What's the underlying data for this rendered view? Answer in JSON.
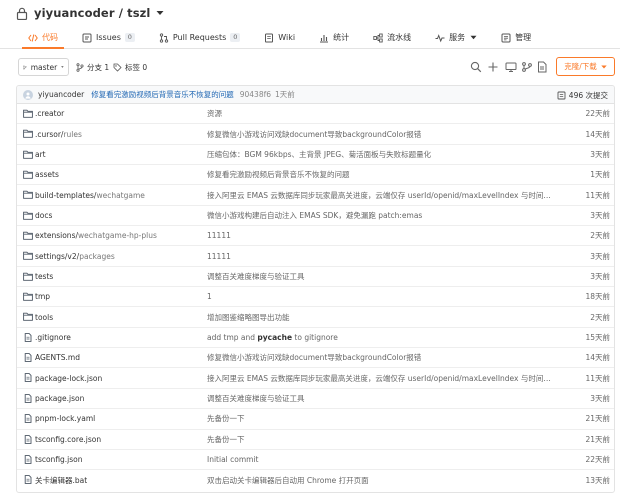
{
  "repo": {
    "title": "yiyuancoder / tszl",
    "lock_icon": "lock-icon"
  },
  "tabs": [
    {
      "label": "代码",
      "icon": "code-icon",
      "active": true
    },
    {
      "label": "Issues",
      "icon": "issues-icon",
      "badge": "0"
    },
    {
      "label": "Pull Requests",
      "icon": "pull-request-icon",
      "badge": "0"
    },
    {
      "label": "Wiki",
      "icon": "wiki-icon"
    },
    {
      "label": "统计",
      "icon": "stats-icon"
    },
    {
      "label": "流水线",
      "icon": "pipeline-icon"
    },
    {
      "label": "服务",
      "icon": "pulse-icon",
      "dropdown": true
    },
    {
      "label": "管理",
      "icon": "settings-icon"
    }
  ],
  "toolbar": {
    "branch": "master",
    "branches": "分支 1",
    "tags": "标签 0",
    "clone_label": "克隆/下载"
  },
  "commit": {
    "author": "yiyuancoder",
    "message": "修复看完激励视频后背景音乐不恢复的问题",
    "sha": "90438f6",
    "time": "1天前",
    "count": "496 次提交"
  },
  "files": [
    {
      "type": "folder",
      "name": ".creator",
      "message": "资源",
      "time": "22天前"
    },
    {
      "type": "folder",
      "name": ".cursor/",
      "name_dim": "rules",
      "message": "修复微信小游戏访问戏缺document导致backgroundColor报错",
      "time": "14天前"
    },
    {
      "type": "folder",
      "name": "art",
      "message": "压缩包体：BGM 96kbps、主背景 JPEG、菊活面板与失败标题量化",
      "time": "3天前"
    },
    {
      "type": "folder",
      "name": "assets",
      "message": "修复看完激励视频后背景音乐不恢复的问题",
      "time": "1天前"
    },
    {
      "type": "folder",
      "name": "build-templates/",
      "name_dim": "wechatgame",
      "message": "接入阿里云 EMAS 云数据库同步玩家最高关进度，云端仅存 userId/openid/maxLevelIndex 与时间戳，并将...",
      "time": "11天前"
    },
    {
      "type": "folder",
      "name": "docs",
      "message": "微信小游戏构建后自动注入 EMAS SDK，避免漏跑 patch:emas",
      "time": "3天前"
    },
    {
      "type": "folder",
      "name": "extensions/",
      "name_dim": "wechatgame-hp-plus",
      "message": "11111",
      "time": "2天前"
    },
    {
      "type": "folder",
      "name": "settings/v2/",
      "name_dim": "packages",
      "message": "11111",
      "time": "3天前"
    },
    {
      "type": "folder",
      "name": "tests",
      "message": "调整百关难度梯度与验证工具",
      "time": "3天前"
    },
    {
      "type": "folder",
      "name": "tmp",
      "message": "1",
      "time": "18天前"
    },
    {
      "type": "folder",
      "name": "tools",
      "message": "增加图鉴缩略图导出功能",
      "time": "2天前"
    },
    {
      "type": "file",
      "name": ".gitignore",
      "message_pre": "add tmp and ",
      "message_bold": "pycache",
      "message_post": " to gitignore",
      "time": "15天前"
    },
    {
      "type": "file",
      "name": "AGENTS.md",
      "message": "修复微信小游戏访问戏缺document导致backgroundColor报错",
      "time": "14天前"
    },
    {
      "type": "file",
      "name": "package-lock.json",
      "message": "接入阿里云 EMAS 云数据库同步玩家最高关进度，云端仅存 userId/openid/maxLevelIndex 与时间戳，并将...",
      "time": "11天前"
    },
    {
      "type": "file",
      "name": "package.json",
      "message": "调整百关难度梯度与验证工具",
      "time": "3天前"
    },
    {
      "type": "file",
      "name": "pnpm-lock.yaml",
      "message": "先备份一下",
      "time": "21天前"
    },
    {
      "type": "file",
      "name": "tsconfig.core.json",
      "message": "先备份一下",
      "time": "21天前"
    },
    {
      "type": "file",
      "name": "tsconfig.json",
      "message": "Initial commit",
      "time": "22天前"
    },
    {
      "type": "file",
      "name": "关卡编辑器.bat",
      "message": "双击启动关卡编辑器后自动用 Chrome 打开页面",
      "time": "13天前"
    }
  ],
  "colors": {
    "accent": "#fa7a2a",
    "link": "#1f66b3",
    "folder": "#4a5562"
  }
}
